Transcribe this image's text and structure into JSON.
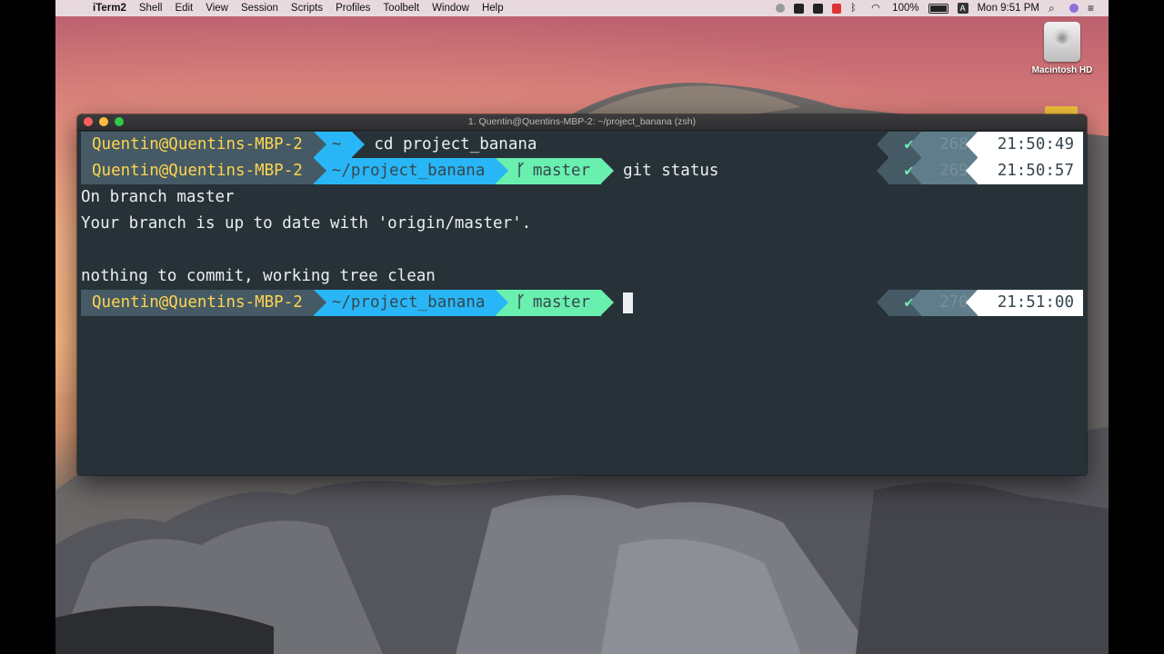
{
  "menubar": {
    "app_name": "iTerm2",
    "items": [
      "Shell",
      "Edit",
      "View",
      "Session",
      "Scripts",
      "Profiles",
      "Toolbelt",
      "Window",
      "Help"
    ],
    "battery_percent": "100%",
    "clock": "Mon 9:51 PM",
    "input_source": "A"
  },
  "desktop": {
    "drive_label": "Macintosh HD"
  },
  "window": {
    "title": "1. Quentin@Quentins-MBP-2: ~/project_banana (zsh)"
  },
  "colors": {
    "terminal_bg": "#263238",
    "user_segment": "#455a64",
    "user_text": "#ffd54f",
    "dir_segment": "#29b6f6",
    "git_segment": "#69f0ae",
    "time_segment": "#ffffff"
  },
  "terminal": {
    "prompt1": {
      "user": "Quentin@Quentins-MBP-2",
      "dir": "~",
      "command": "cd project_banana",
      "status": "✔",
      "history": "268",
      "time": "21:50:49"
    },
    "prompt2": {
      "user": "Quentin@Quentins-MBP-2",
      "dir": "~/project_banana",
      "branch": "master",
      "command": "git status",
      "status": "✔",
      "history": "269",
      "time": "21:50:57"
    },
    "output": [
      "On branch master",
      "Your branch is up to date with 'origin/master'.",
      "",
      "nothing to commit, working tree clean"
    ],
    "prompt3": {
      "user": "Quentin@Quentins-MBP-2",
      "dir": "~/project_banana",
      "branch": "master",
      "status": "✔",
      "history": "270",
      "time": "21:51:00"
    }
  }
}
